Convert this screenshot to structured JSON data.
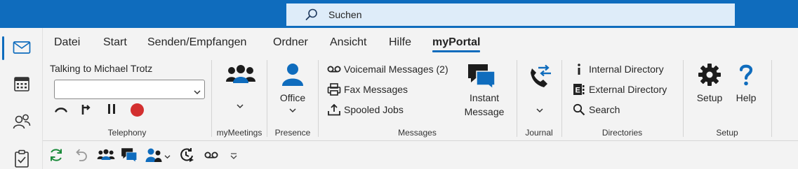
{
  "search": {
    "placeholder": "Suchen",
    "icon": "search-icon"
  },
  "nav": [
    "mail-icon",
    "calendar-icon",
    "people-icon",
    "tasks-icon"
  ],
  "tabs": [
    "Datei",
    "Start",
    "Senden/Empfangen",
    "Ordner",
    "Ansicht",
    "Hilfe",
    "myPortal"
  ],
  "active_tab": "myPortal",
  "telephony": {
    "status": "Talking to Michael Trotz",
    "combo_value": "",
    "label": "Telephony",
    "controls": [
      "hangup-icon",
      "transfer-icon",
      "pause-icon",
      "record-icon"
    ]
  },
  "mymeetings": {
    "label": "myMeetings"
  },
  "presence": {
    "button": "Office",
    "label": "Presence"
  },
  "messages": {
    "items": [
      "Voicemail Messages (2)",
      "Fax Messages",
      "Spooled Jobs"
    ],
    "instant_1": "Instant",
    "instant_2": "Message",
    "label": "Messages"
  },
  "journal": {
    "label": "Journal"
  },
  "directories": {
    "items": [
      "Internal Directory",
      "External Directory",
      "Search"
    ],
    "label": "Directories"
  },
  "setup": {
    "setup_btn": "Setup",
    "help_btn": "Help",
    "label": "Setup"
  },
  "colors": {
    "accent": "#0f6cbd",
    "search_bg": "#deecf9",
    "record": "#d32f2f"
  },
  "qat": [
    "refresh-icon",
    "undo-icon",
    "meetings-icon",
    "chat-icon",
    "contacts-icon",
    "journal-clock-icon",
    "voicemail-icon",
    "customize-icon"
  ]
}
